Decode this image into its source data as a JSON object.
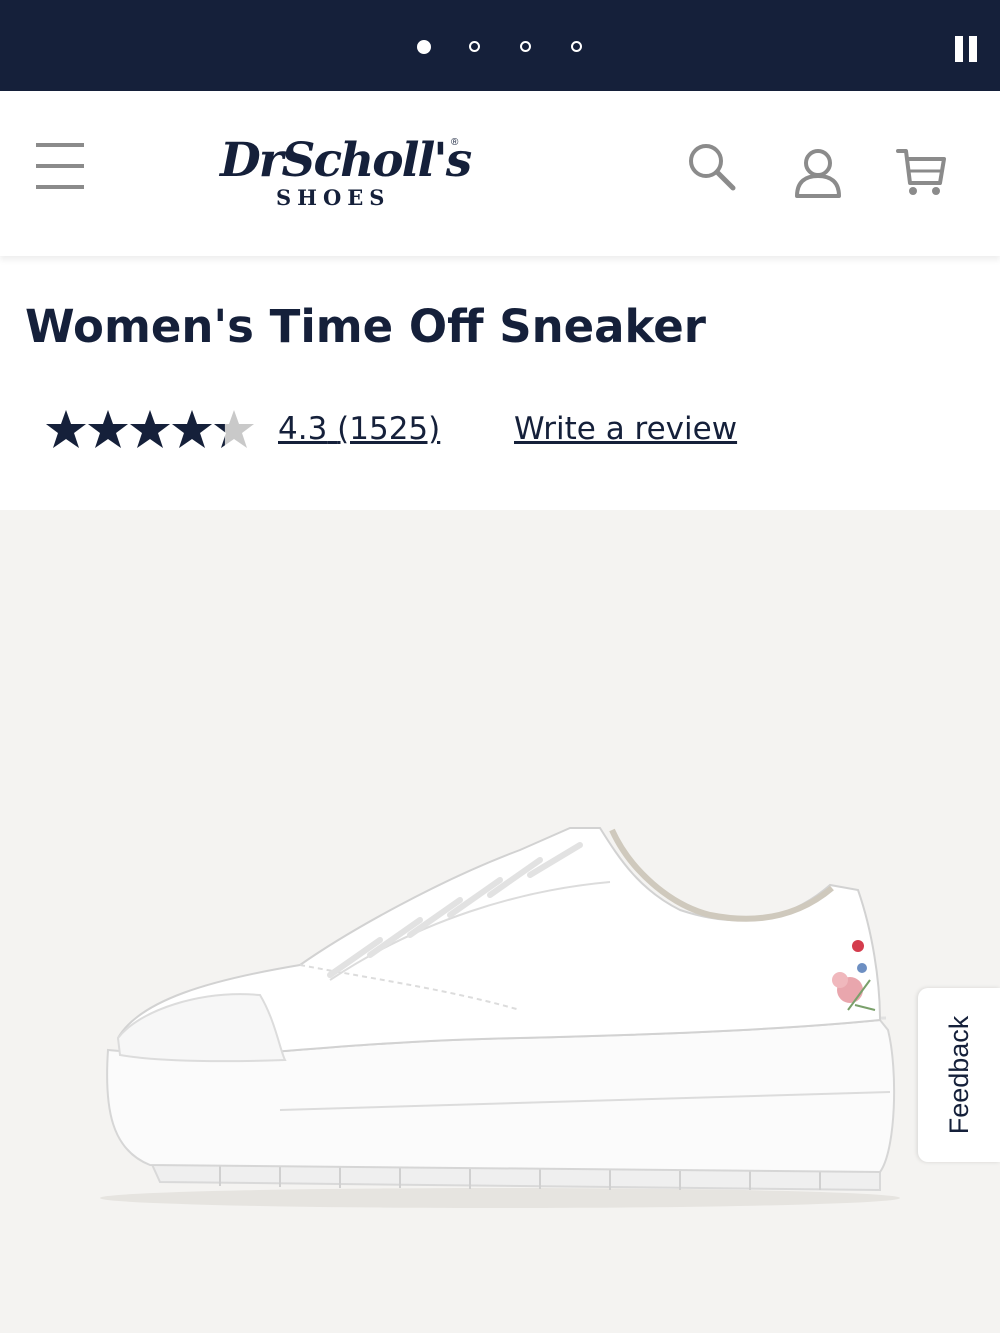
{
  "brand": {
    "logo_main": "DrScholl's",
    "logo_sub": "SHOES",
    "navy": "#15203a"
  },
  "promo_banner": {
    "slides": 4,
    "active_slide": 1,
    "pause_icon": "pause-icon"
  },
  "header": {
    "menu_icon": "hamburger-menu-icon",
    "search_icon": "search-icon",
    "account_icon": "user-icon",
    "cart_icon": "cart-icon"
  },
  "product": {
    "title": "Women's Time Off Sneaker",
    "rating_value": 4.3,
    "rating_max": 5,
    "rating_text": "4.3",
    "review_count": "(1525)",
    "write_review": "Write a review",
    "image": "white platform sneaker with floral embroidery on heel"
  },
  "feedback_tab": {
    "label": "Feedback"
  }
}
